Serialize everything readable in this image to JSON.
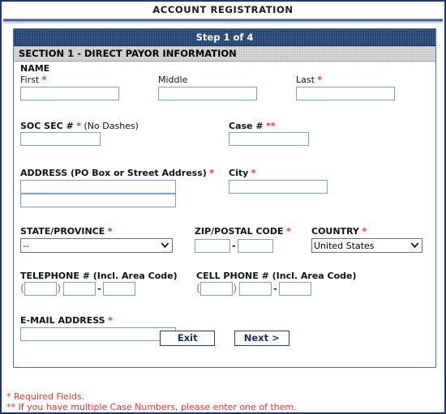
{
  "page": {
    "title": "ACCOUNT REGISTRATION"
  },
  "form": {
    "step_bar": "Step 1 of 4",
    "section_bar": "SECTION 1 - DIRECT PAYOR INFORMATION",
    "name_group_label": "NAME",
    "fields": {
      "first": {
        "label": "First",
        "required": "*",
        "value": ""
      },
      "middle": {
        "label": "Middle",
        "required": "",
        "value": ""
      },
      "last": {
        "label": "Last",
        "required": "*",
        "value": ""
      },
      "soc_sec": {
        "label": "SOC SEC #",
        "required": "*",
        "note": "(No Dashes)",
        "value": ""
      },
      "case": {
        "label": "Case #",
        "required": "**",
        "value": ""
      },
      "address": {
        "label": "ADDRESS (PO Box or Street Address)",
        "required": "*",
        "line1": "",
        "line2": ""
      },
      "city": {
        "label": "City",
        "required": "*",
        "value": ""
      },
      "state": {
        "label": "STATE/PROVINCE",
        "required": "*",
        "value": "--"
      },
      "zip": {
        "label": "ZIP/POSTAL CODE",
        "required": "*",
        "value": "",
        "separator": "-",
        "value_ext": ""
      },
      "country": {
        "label": "COUNTRY",
        "required": "*",
        "value": "United States"
      },
      "telephone": {
        "label": "TELEPHONE # (Incl. Area Code)",
        "open_paren": "(",
        "close_paren": ")",
        "separator": "-",
        "area": "",
        "prefix": "",
        "line": ""
      },
      "cellphone": {
        "label": "CELL PHONE # (Incl. Area Code)",
        "open_paren": "(",
        "close_paren": ")",
        "separator": "-",
        "area": "",
        "prefix": "",
        "line": ""
      },
      "email": {
        "label": "E-MAIL ADDRESS",
        "required": "*",
        "value": ""
      }
    },
    "buttons": {
      "exit": "Exit",
      "next": "Next >"
    }
  },
  "footnotes": {
    "line1": "* Required Fields.",
    "line2": "** If you have multiple Case Numbers, please enter one of them."
  },
  "colors": {
    "accent_navy": "#1f4172",
    "required_red": "#ff2d2d",
    "section_gray": "#c6c6c6",
    "input_border": "#7ba2cc",
    "button_text": "#16306b"
  }
}
